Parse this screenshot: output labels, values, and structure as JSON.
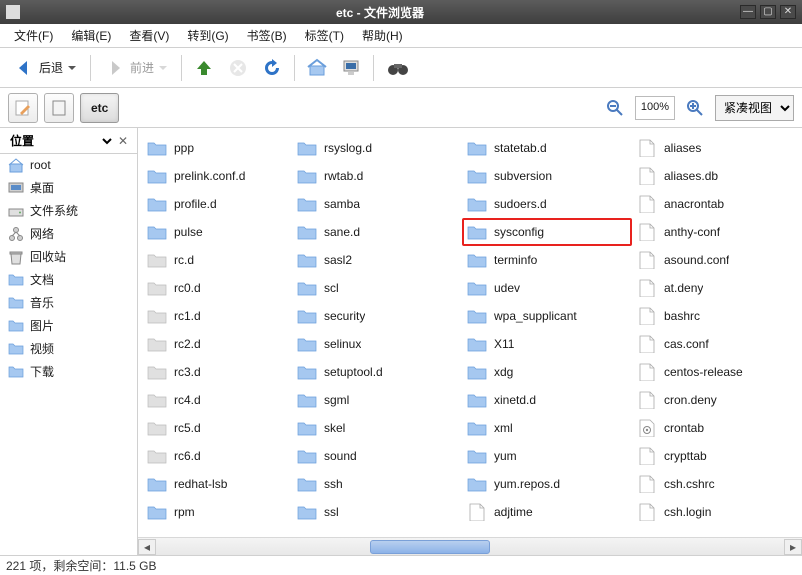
{
  "window": {
    "title": "etc - 文件浏览器"
  },
  "menu": {
    "file": "文件(F)",
    "edit": "编辑(E)",
    "view": "查看(V)",
    "go": "转到(G)",
    "bookmarks": "书签(B)",
    "tabs": "标签(T)",
    "help": "帮助(H)"
  },
  "toolbar": {
    "back": "后退",
    "forward": "前进"
  },
  "location": {
    "crumb": "etc",
    "zoom": "100%",
    "view_mode": "紧凑视图"
  },
  "sidebar": {
    "header": "位置",
    "items": [
      {
        "name": "root",
        "icon": "home"
      },
      {
        "name": "桌面",
        "icon": "desktop"
      },
      {
        "name": "文件系统",
        "icon": "drive"
      },
      {
        "name": "网络",
        "icon": "network"
      },
      {
        "name": "回收站",
        "icon": "trash"
      },
      {
        "name": "文档",
        "icon": "folder"
      },
      {
        "name": "音乐",
        "icon": "folder"
      },
      {
        "name": "图片",
        "icon": "folder"
      },
      {
        "name": "视频",
        "icon": "folder"
      },
      {
        "name": "下载",
        "icon": "folder"
      }
    ]
  },
  "files": {
    "columns": [
      [
        {
          "name": "ppp",
          "type": "folder"
        },
        {
          "name": "prelink.conf.d",
          "type": "folder"
        },
        {
          "name": "profile.d",
          "type": "folder"
        },
        {
          "name": "pulse",
          "type": "folder"
        },
        {
          "name": "rc.d",
          "type": "folder-faded"
        },
        {
          "name": "rc0.d",
          "type": "folder-faded"
        },
        {
          "name": "rc1.d",
          "type": "folder-faded"
        },
        {
          "name": "rc2.d",
          "type": "folder-faded"
        },
        {
          "name": "rc3.d",
          "type": "folder-faded"
        },
        {
          "name": "rc4.d",
          "type": "folder-faded"
        },
        {
          "name": "rc5.d",
          "type": "folder-faded"
        },
        {
          "name": "rc6.d",
          "type": "folder-faded"
        },
        {
          "name": "redhat-lsb",
          "type": "folder"
        },
        {
          "name": "rpm",
          "type": "folder"
        }
      ],
      [
        {
          "name": "rsyslog.d",
          "type": "folder"
        },
        {
          "name": "rwtab.d",
          "type": "folder"
        },
        {
          "name": "samba",
          "type": "folder"
        },
        {
          "name": "sane.d",
          "type": "folder"
        },
        {
          "name": "sasl2",
          "type": "folder"
        },
        {
          "name": "scl",
          "type": "folder"
        },
        {
          "name": "security",
          "type": "folder"
        },
        {
          "name": "selinux",
          "type": "folder"
        },
        {
          "name": "setuptool.d",
          "type": "folder"
        },
        {
          "name": "sgml",
          "type": "folder"
        },
        {
          "name": "skel",
          "type": "folder"
        },
        {
          "name": "sound",
          "type": "folder"
        },
        {
          "name": "ssh",
          "type": "folder"
        },
        {
          "name": "ssl",
          "type": "folder"
        }
      ],
      [
        {
          "name": "statetab.d",
          "type": "folder"
        },
        {
          "name": "subversion",
          "type": "folder"
        },
        {
          "name": "sudoers.d",
          "type": "folder"
        },
        {
          "name": "sysconfig",
          "type": "folder",
          "highlight": true
        },
        {
          "name": "terminfo",
          "type": "folder"
        },
        {
          "name": "udev",
          "type": "folder"
        },
        {
          "name": "wpa_supplicant",
          "type": "folder"
        },
        {
          "name": "X11",
          "type": "folder"
        },
        {
          "name": "xdg",
          "type": "folder"
        },
        {
          "name": "xinetd.d",
          "type": "folder"
        },
        {
          "name": "xml",
          "type": "folder"
        },
        {
          "name": "yum",
          "type": "folder"
        },
        {
          "name": "yum.repos.d",
          "type": "folder"
        },
        {
          "name": "adjtime",
          "type": "file"
        }
      ],
      [
        {
          "name": "aliases",
          "type": "file"
        },
        {
          "name": "aliases.db",
          "type": "file"
        },
        {
          "name": "anacrontab",
          "type": "file"
        },
        {
          "name": "anthy-conf",
          "type": "file"
        },
        {
          "name": "asound.conf",
          "type": "file"
        },
        {
          "name": "at.deny",
          "type": "file"
        },
        {
          "name": "bashrc",
          "type": "file"
        },
        {
          "name": "cas.conf",
          "type": "file"
        },
        {
          "name": "centos-release",
          "type": "file"
        },
        {
          "name": "cron.deny",
          "type": "file"
        },
        {
          "name": "crontab",
          "type": "file-gear"
        },
        {
          "name": "crypttab",
          "type": "file"
        },
        {
          "name": "csh.cshrc",
          "type": "file"
        },
        {
          "name": "csh.login",
          "type": "file"
        }
      ]
    ]
  },
  "status": {
    "text": "221 项，剩余空间：11.5 GB"
  }
}
